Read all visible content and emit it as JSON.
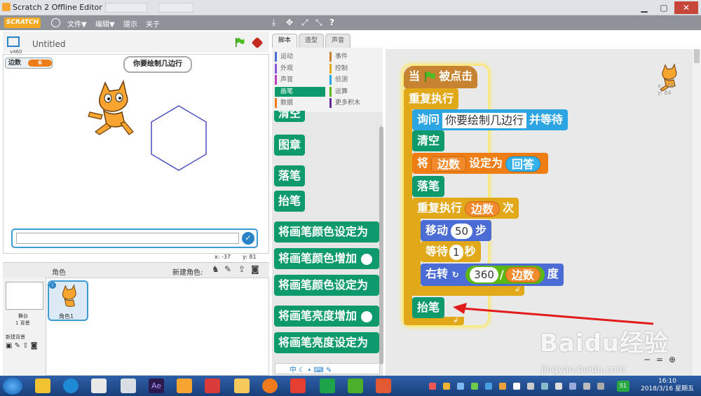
{
  "window": {
    "title": "Scratch 2 Offline Editor"
  },
  "menubar": {
    "logo": "SCRATCH",
    "file": "文件▼",
    "edit": "编辑▼",
    "tips": "提示",
    "about": "关于"
  },
  "toolbar": {
    "duplicate": "⤓",
    "delete": "✥",
    "grow": "⤢",
    "shrink": "⤡",
    "help": "?"
  },
  "stage": {
    "version": "v460",
    "project_title": "Untitled",
    "variable_name": "边数",
    "variable_value": "6",
    "speech": "你要绘制几边行",
    "mouse_x": "x: -37",
    "mouse_y": "y: 81"
  },
  "sprites": {
    "header": "角色",
    "new_sprite": "新建角色:",
    "stage_label": "舞台",
    "backdrop_count": "1 背景",
    "new_backdrop": "新建背景",
    "sprite_name": "角色1"
  },
  "tabs": [
    "脚本",
    "造型",
    "声音"
  ],
  "categories": {
    "left": [
      "运动",
      "外观",
      "声音",
      "画笔",
      "数据"
    ],
    "right": [
      "事件",
      "控制",
      "侦测",
      "运算",
      "更多积木"
    ],
    "colors_left": [
      "#4a6cd4",
      "#8a55d7",
      "#bb42c3",
      "#0e9a6c",
      "#ee7d16"
    ],
    "colors_right": [
      "#c88330",
      "#e1a91a",
      "#2ca5e2",
      "#5cb712",
      "#632d99"
    ]
  },
  "palette_blocks": [
    "清空",
    "图章",
    "落笔",
    "抬笔",
    "将画笔颜色设定为",
    "将画笔颜色增加",
    "将画笔颜色设定为",
    "将画笔亮度增加",
    "将画笔亮度设定为"
  ],
  "script": {
    "hat_when": "当",
    "hat_clicked": "被点击",
    "forever": "重复执行",
    "ask_label": "询问",
    "ask_text": "你要绘制几边行",
    "ask_wait": "并等待",
    "clear": "清空",
    "set_label": "将",
    "set_var": "边数",
    "set_to": "设定为",
    "answer": "回答",
    "pen_down": "落笔",
    "repeat_label": "重复执行",
    "repeat_var": "边数",
    "repeat_times": "次",
    "move_label": "移动",
    "move_steps": "50",
    "move_unit": "步",
    "wait_label": "等待",
    "wait_secs": "1",
    "wait_unit": "秒",
    "turn_label": "右转",
    "turn_deg": "360",
    "turn_div": "/",
    "turn_var": "边数",
    "turn_unit": "度",
    "pen_up": "抬笔"
  },
  "sprite_info": {
    "x": "x: -38",
    "y": "y: 84"
  },
  "watermark": {
    "brand": "Baidu经验",
    "url": "jingyan.baidu.com"
  },
  "taskbar": {
    "time": "16:10",
    "date": "2018/3/16 星期五",
    "badge": "51"
  }
}
